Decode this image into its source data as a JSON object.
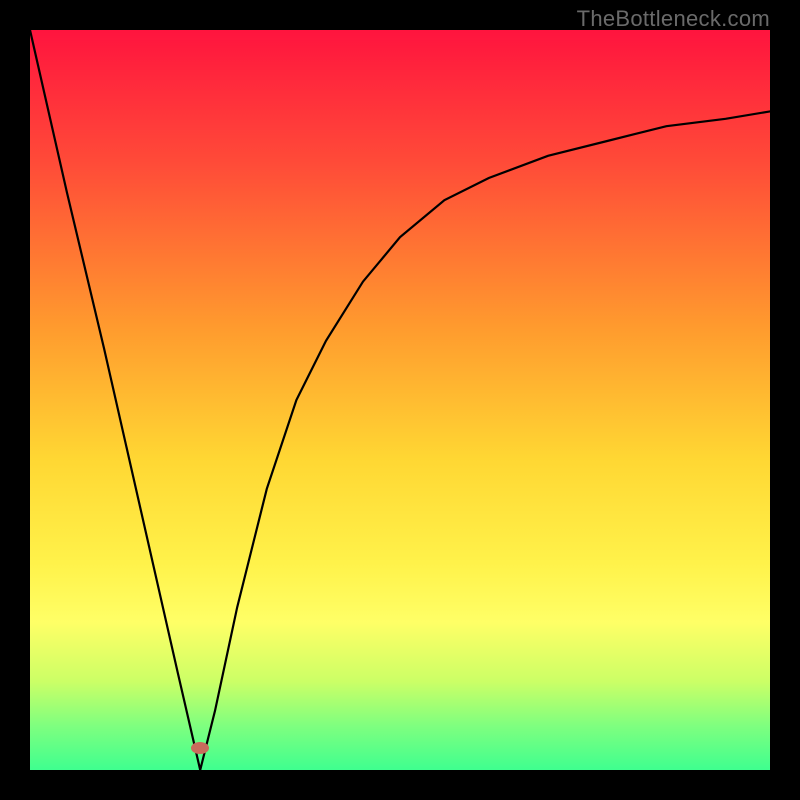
{
  "watermark": "TheBottleneck.com",
  "gradient": {
    "stops": [
      {
        "offset": 0.0,
        "color": "#ff143e"
      },
      {
        "offset": 0.18,
        "color": "#ff4b38"
      },
      {
        "offset": 0.4,
        "color": "#ff9a2e"
      },
      {
        "offset": 0.58,
        "color": "#ffd733"
      },
      {
        "offset": 0.72,
        "color": "#fff24a"
      },
      {
        "offset": 0.8,
        "color": "#ffff66"
      },
      {
        "offset": 0.88,
        "color": "#ccff66"
      },
      {
        "offset": 0.94,
        "color": "#7fff7f"
      },
      {
        "offset": 1.0,
        "color": "#3fff8f"
      }
    ]
  },
  "marker": {
    "x_pct": 23,
    "y_pct": 97,
    "color": "#c96b5c"
  },
  "chart_data": {
    "type": "line",
    "title": "",
    "xlabel": "",
    "ylabel": "",
    "xlim": [
      0,
      100
    ],
    "ylim": [
      0,
      100
    ],
    "grid": false,
    "legend": false,
    "annotations": [
      "TheBottleneck.com"
    ],
    "series": [
      {
        "name": "left-descent",
        "x": [
          0,
          5,
          10,
          15,
          20,
          23
        ],
        "y": [
          100,
          78,
          57,
          35,
          13,
          0
        ]
      },
      {
        "name": "right-ascent-curve",
        "x": [
          23,
          25,
          28,
          32,
          36,
          40,
          45,
          50,
          56,
          62,
          70,
          78,
          86,
          94,
          100
        ],
        "y": [
          0,
          8,
          22,
          38,
          50,
          58,
          66,
          72,
          77,
          80,
          83,
          85,
          87,
          88,
          89
        ]
      }
    ],
    "marker_point": {
      "x": 23,
      "y": 0
    }
  }
}
